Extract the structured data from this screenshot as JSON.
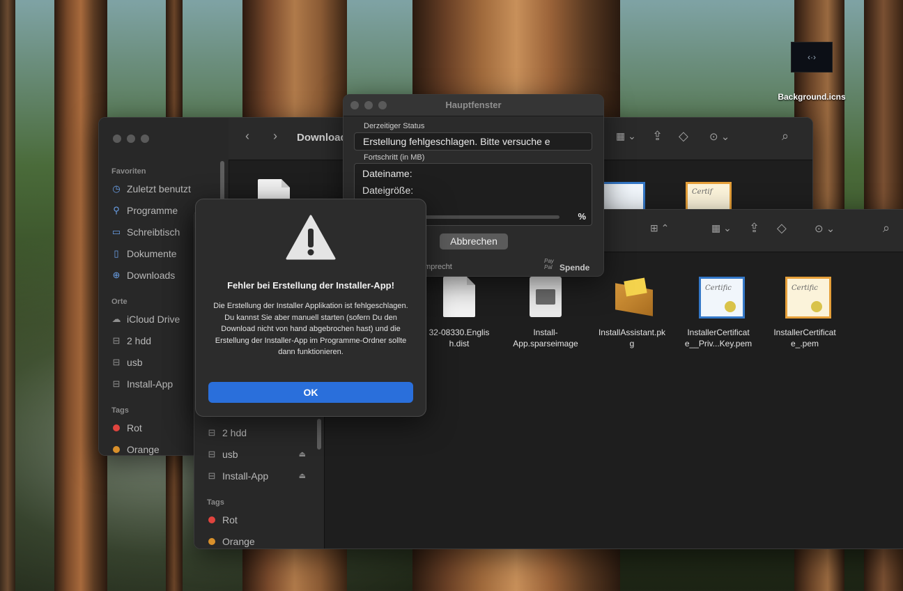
{
  "desktop": {
    "icon_label": "Background.icns"
  },
  "finder_back": {
    "title": "Downloads",
    "sidebar": {
      "favorites_header": "Favoriten",
      "favorites": [
        {
          "label": "Zuletzt benutzt",
          "icon": "clock-icon"
        },
        {
          "label": "Programme",
          "icon": "apps-icon"
        },
        {
          "label": "Schreibtisch",
          "icon": "desktop-icon"
        },
        {
          "label": "Dokumente",
          "icon": "document-icon"
        },
        {
          "label": "Downloads",
          "icon": "download-icon"
        }
      ],
      "locations_header": "Orte",
      "locations": [
        {
          "label": "iCloud Drive",
          "icon": "cloud-icon"
        },
        {
          "label": "2 hdd",
          "icon": "drive-icon"
        },
        {
          "label": "usb",
          "icon": "drive-icon"
        },
        {
          "label": "Install-App",
          "icon": "drive-icon"
        }
      ],
      "tags_header": "Tags",
      "tags": [
        {
          "label": "Rot",
          "color": "#e0443e"
        },
        {
          "label": "Orange",
          "color": "#d9902b"
        }
      ]
    }
  },
  "finder_front": {
    "sidebar": {
      "locations": [
        {
          "label": "2 hdd"
        },
        {
          "label": "usb"
        },
        {
          "label": "Install-App"
        }
      ],
      "tags_header": "Tags",
      "tags": [
        {
          "label": "Rot",
          "color": "#e0443e"
        },
        {
          "label": "Orange",
          "color": "#d9902b"
        }
      ]
    },
    "files": [
      {
        "line1": "32-08330.Englis",
        "line2": "h.dist"
      },
      {
        "line1": "Install-",
        "line2": "App.sparseimage"
      },
      {
        "line1": "InstallAssistant.pk",
        "line2": "g"
      },
      {
        "line1": "InstallerCertificat",
        "line2": "e__Priv...Key.pem"
      },
      {
        "line1": "InstallerCertificat",
        "line2": "e_.pem"
      }
    ]
  },
  "main_window": {
    "title": "Hauptfenster",
    "status_label": "Derzeitiger Status",
    "status_value": "Erstellung fehlgeschlagen. Bitte versuche е",
    "progress_label": "Fortschritt (in MB)",
    "filename_label": "Dateiname:",
    "filesize_label": "Dateigröße:",
    "percent_sign": "%",
    "cancel_label": "Abbrechen",
    "footer_left": "amprecht",
    "footer_paypal": "Pay Pal",
    "footer_right": "Spende"
  },
  "alert": {
    "title": "Fehler bei Erstellung der Installer-App!",
    "message": "Die Erstellung der Installer Applikation ist fehlgeschlagen. Du kannst Sie aber manuell starten (sofern Du den Download nicht von hand abgebrochen hast) und die Erstellung der Installer-App im Programme-Ordner sollte dann funktionieren.",
    "ok_label": "OK"
  }
}
